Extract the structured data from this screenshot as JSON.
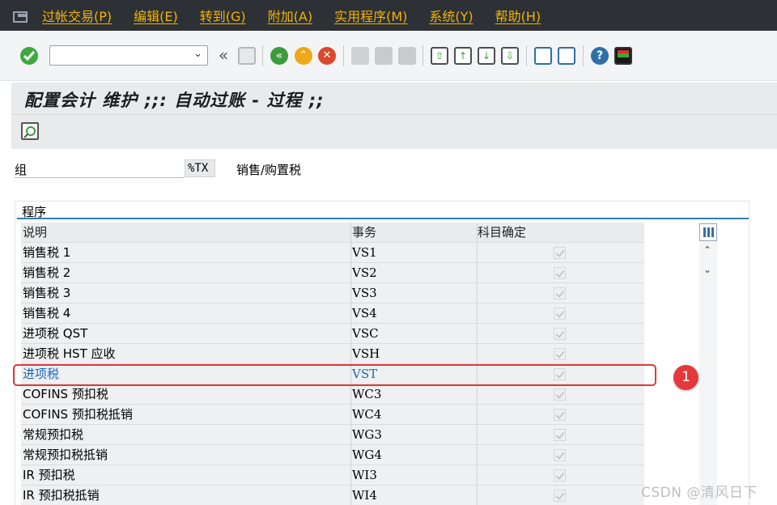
{
  "menu": [
    "过帐交易(P)",
    "编辑(E)",
    "转到(G)",
    "附加(A)",
    "实用程序(M)",
    "系统(Y)",
    "帮助(H)"
  ],
  "toolbar": {
    "command_value": "",
    "icons": [
      "enter-icon",
      "back-icon",
      "save-icon",
      "back-green-icon",
      "exit-icon",
      "cancel-icon",
      "print-icon",
      "find-icon",
      "find-next-icon",
      "first-page-icon",
      "prev-page-icon",
      "next-page-icon",
      "last-page-icon",
      "create-session-icon",
      "shortcut-icon",
      "help-icon",
      "layout-icon"
    ]
  },
  "title": "配置会计 维护 ;;: 自动过账 - 过程 ;;",
  "group": {
    "label": "组",
    "value": "%TX",
    "description": "销售/购置税"
  },
  "panel": {
    "title": "程序"
  },
  "table": {
    "headers": [
      "说明",
      "事务",
      "科目确定"
    ],
    "rows": [
      {
        "desc": "销售税 1",
        "code": "VS1",
        "checked": true
      },
      {
        "desc": "销售税 2",
        "code": "VS2",
        "checked": true
      },
      {
        "desc": "销售税 3",
        "code": "VS3",
        "checked": true
      },
      {
        "desc": "销售税 4",
        "code": "VS4",
        "checked": true
      },
      {
        "desc": "进项税 QST",
        "code": "VSC",
        "checked": true
      },
      {
        "desc": "进项税 HST 应收",
        "code": "VSH",
        "checked": true
      },
      {
        "desc": "进项税",
        "code": "VST",
        "checked": true,
        "selected": true
      },
      {
        "desc": "COFINS 预扣税",
        "code": "WC3",
        "checked": true
      },
      {
        "desc": "COFINS 预扣税抵销",
        "code": "WC4",
        "checked": true
      },
      {
        "desc": "常规预扣税",
        "code": "WG3",
        "checked": true
      },
      {
        "desc": "常规预扣税抵销",
        "code": "WG4",
        "checked": true
      },
      {
        "desc": "IR 预扣税",
        "code": "WI3",
        "checked": true
      },
      {
        "desc": "IR 预扣税抵销",
        "code": "WI4",
        "checked": true
      }
    ]
  },
  "annotation": {
    "number": "1",
    "color": "#e4393c"
  },
  "watermark": "CSDN @清风日下",
  "colors": {
    "menubar": "#2d3035",
    "menu_text": "#f0b400",
    "accent": "#2f7fb2",
    "selected_text": "#1867c0"
  }
}
